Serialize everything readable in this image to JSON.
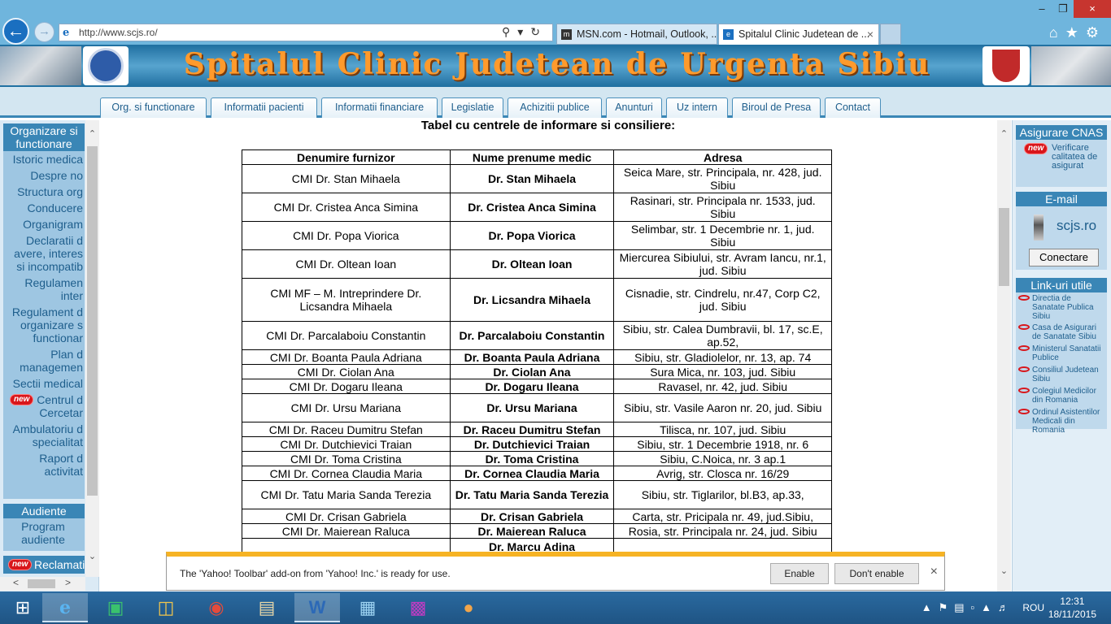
{
  "browser": {
    "url": "http://www.scjs.ro/",
    "tabs": [
      {
        "title": "MSN.com - Hotmail, Outlook, ..."
      },
      {
        "title": "Spitalul Clinic Judetean de ..."
      }
    ],
    "nav_icons": [
      "back-arrow-icon",
      "forward-arrow-icon",
      "search-icon",
      "refresh-icon",
      "home-icon",
      "favorites-star-icon",
      "settings-gear-icon"
    ]
  },
  "site": {
    "title": "Spitalul Clinic Judetean de Urgenta Sibiu",
    "menu": [
      "Org. si functionare",
      "Informatii pacienti",
      "Informatii financiare",
      "Legislatie",
      "Achizitii publice",
      "Anunturi",
      "Uz intern",
      "Biroul de Presa",
      "Contact"
    ]
  },
  "left_menu": {
    "header": "Organizare si functionare",
    "items": [
      "Istoric medica",
      "Despre no",
      "Structura org",
      "Conducere",
      "Organigram",
      "Declaratii d\navere, interes\nsi incompatib",
      "Regulamen\ninter",
      "Regulament d\norganizare s\nfunctionar",
      "Plan d\nmanagemen",
      "Sectii medical",
      "Centrul d\nCercetar",
      "Ambulatoriu d\nspecialitat",
      "Raport d\nactivitat"
    ],
    "new_badge": "new",
    "audiente_header": "Audiente",
    "audiente_item": "Program\naudiente",
    "reclamatii": "Reclamati"
  },
  "content": {
    "title": "Tabel cu centrele de informare si consiliere:",
    "columns": [
      "Denumire furnizor",
      "Nume prenume medic",
      "Adresa"
    ],
    "rows": [
      [
        "CMI Dr. Stan Mihaela",
        "Dr. Stan Mihaela",
        "Seica Mare, str. Principala, nr. 428, jud. Sibiu"
      ],
      [
        "CMI Dr. Cristea Anca Simina",
        "Dr. Cristea Anca Simina",
        "Rasinari, str. Principala nr. 1533, jud. Sibiu"
      ],
      [
        "CMI Dr. Popa Viorica",
        "Dr. Popa Viorica",
        "Selimbar, str. 1 Decembrie nr. 1, jud. Sibiu"
      ],
      [
        "CMI Dr. Oltean Ioan",
        "Dr. Oltean Ioan",
        "Miercurea Sibiului, str. Avram Iancu, nr.1, jud. Sibiu"
      ],
      [
        "CMI MF – M. Intreprindere Dr. Licsandra Mihaela",
        "Dr. Licsandra Mihaela",
        "Cisnadie, str. Cindrelu, nr.47, Corp C2, jud. Sibiu"
      ],
      [
        "CMI Dr. Parcalaboiu Constantin",
        "Dr. Parcalaboiu Constantin",
        "Sibiu, str. Calea Dumbravii, bl. 17, sc.E, ap.52,"
      ],
      [
        "CMI Dr. Boanta Paula Adriana",
        "Dr. Boanta Paula Adriana",
        "Sibiu, str. Gladiolelor, nr. 13, ap. 74"
      ],
      [
        "CMI Dr. Ciolan Ana",
        "Dr. Ciolan Ana",
        "Sura Mica, nr. 103, jud. Sibiu"
      ],
      [
        "CMI Dr. Dogaru Ileana",
        "Dr. Dogaru Ileana",
        "Ravasel, nr. 42, jud. Sibiu"
      ],
      [
        "CMI Dr. Ursu Mariana",
        "Dr. Ursu Mariana",
        "Sibiu, str. Vasile Aaron nr. 20, jud. Sibiu"
      ],
      [
        "CMI Dr. Raceu Dumitru Stefan",
        "Dr. Raceu Dumitru Stefan",
        "Tilisca, nr. 107, jud. Sibiu"
      ],
      [
        "CMI Dr. Dutchievici Traian",
        "Dr. Dutchievici Traian",
        "Sibiu, str. 1 Decembrie 1918, nr. 6"
      ],
      [
        "CMI Dr. Toma Cristina",
        "Dr. Toma Cristina",
        "Sibiu, C.Noica, nr. 3 ap.1"
      ],
      [
        "CMI Dr. Cornea Claudia Maria",
        "Dr. Cornea Claudia Maria",
        "Avrig, str. Closca nr. 16/29"
      ],
      [
        "CMI Dr. Tatu Maria Sanda Terezia",
        "Dr. Tatu Maria Sanda Terezia",
        "Sibiu, str. Tiglarilor, bl.B3, ap.33,"
      ],
      [
        "CMI Dr. Crisan Gabriela",
        "Dr. Crisan Gabriela",
        "Carta, str. Pricipala nr. 49, jud.Sibiu,"
      ],
      [
        "CMI Dr. Maierean Raluca",
        "Dr. Maierean Raluca",
        "Rosia, str. Principala nr. 24, jud. Sibiu"
      ],
      [
        "",
        "Dr. Marcu   Adina",
        ""
      ]
    ]
  },
  "right_col": {
    "cnas_header": "Asigurare CNAS",
    "new_badge": "new",
    "cnas_link": "Verificare calitatea de asigurat",
    "email_header": "E-mail",
    "email_domain": "scjs.ro",
    "connect_button": "Conectare",
    "links_header": "Link-uri utile",
    "links": [
      "Directia de Sanatate Publica Sibiu",
      "Casa de Asigurari de Sanatate Sibiu",
      "Ministerul Sanatatii Publice",
      "Consiliul Judetean Sibiu",
      "Colegiul Medicilor din Romania",
      "Ordinul Asistentilor Medicali din Romania"
    ]
  },
  "notification": {
    "message": "The 'Yahoo! Toolbar' add-on from 'Yahoo! Inc.' is ready for use.",
    "enable": "Enable",
    "dont_enable": "Don't enable"
  },
  "taskbar": {
    "apps": [
      "start-windows-icon",
      "internet-explorer-icon",
      "store-icon",
      "file-explorer-icon",
      "chrome-icon",
      "card-viewer-icon",
      "word-icon",
      "notepad-icon",
      "floppy-save-icon",
      "paint-icon"
    ],
    "lang": "ROU",
    "time": "12:31",
    "date": "18/11/2015"
  }
}
